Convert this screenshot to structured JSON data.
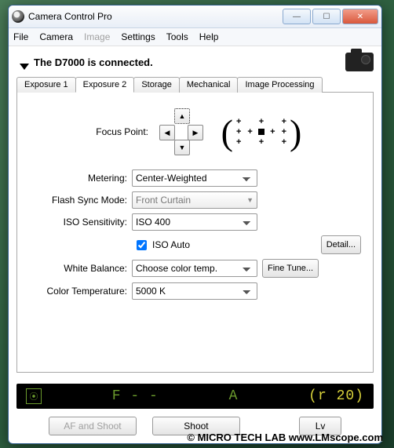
{
  "window": {
    "title": "Camera Control Pro"
  },
  "menu": {
    "file": "File",
    "camera": "Camera",
    "image": "Image",
    "settings": "Settings",
    "tools": "Tools",
    "help": "Help"
  },
  "status": {
    "text": "The D7000 is connected."
  },
  "tabs": {
    "exposure1": "Exposure 1",
    "exposure2": "Exposure 2",
    "storage": "Storage",
    "mechanical": "Mechanical",
    "imageprocessing": "Image Processing"
  },
  "labels": {
    "focus_point": "Focus Point:",
    "metering": "Metering:",
    "flash_sync": "Flash Sync Mode:",
    "iso": "ISO Sensitivity:",
    "iso_auto": "ISO Auto",
    "white_balance": "White Balance:",
    "color_temp": "Color Temperature:"
  },
  "values": {
    "metering": "Center-Weighted",
    "flash_sync": "Front Curtain",
    "iso": "ISO 400",
    "iso_auto_checked": true,
    "white_balance": "Choose color temp.",
    "color_temp": "5000 K"
  },
  "buttons": {
    "detail": "Detail...",
    "fine_tune": "Fine Tune...",
    "af_shoot": "AF and Shoot",
    "shoot": "Shoot",
    "lv": "Lv"
  },
  "lcd": {
    "aperture": "F - -",
    "mode": "A",
    "remaining": "(r 20)"
  },
  "watermark": "© MICRO TECH LAB   www.LMscope.com"
}
